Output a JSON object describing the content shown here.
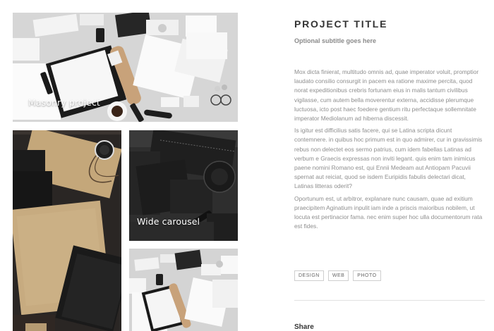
{
  "gallery": {
    "tiles": [
      {
        "caption": "Masonry project",
        "scene": "light-stationery-flatlay"
      },
      {
        "caption": "",
        "scene": "kraft-folders-dark-wood"
      },
      {
        "caption": "Wide carousel",
        "scene": "black-stationery-set"
      },
      {
        "caption": "",
        "scene": "light-stationery-flatlay"
      }
    ]
  },
  "project": {
    "title": "PROJECT TITLE",
    "subtitle": "Optional subtitle goes here",
    "paragraphs": [
      "Mox dicta finierat, multitudo omnis ad, quae imperator voluit, promptior laudato consilio consurgit in pacem ea ratione maxime percita, quod norat expeditionibus crebris fortunam eius in malis tantum civilibus vigilasse, cum autem bella moverentur externa, accidisse plerumque luctuosa, icto post haec foedere gentium ritu perfectaque sollemnitate imperator Mediolanum ad hiberna discessit.",
      "Is igitur est difficilius satis facere, qui se Latina scripta dicunt contemnere. in quibus hoc primum est in quo admirer, cur in gravissimis rebus non delectet eos sermo patrius, cum idem fabellas Latinas ad verbum e Graecis expressas non inviti legant. quis enim tam inimicus paene nomini Romano est, qui Ennii Medeam aut Antiopam Pacuvii spernat aut reiciat, quod se isdem Euripidis fabulis delectari dicat, Latinas litteras oderit?",
      "Oportunum est, ut arbitror, explanare nunc causam, quae ad exitium praecipitem Aginatium inpulit iam inde a priscis maioribus nobilem, ut locuta est pertinacior fama. nec enim super hoc ulla documentorum rata est fides."
    ],
    "tags": [
      "DESIGN",
      "WEB",
      "PHOTO"
    ],
    "share_heading": "Share"
  },
  "colors": {
    "title": "#333333",
    "subtitle": "#8a8a8a",
    "body_text": "#8e8e8e",
    "tag_border": "#cfcfcf",
    "caption": "#ffffff"
  }
}
